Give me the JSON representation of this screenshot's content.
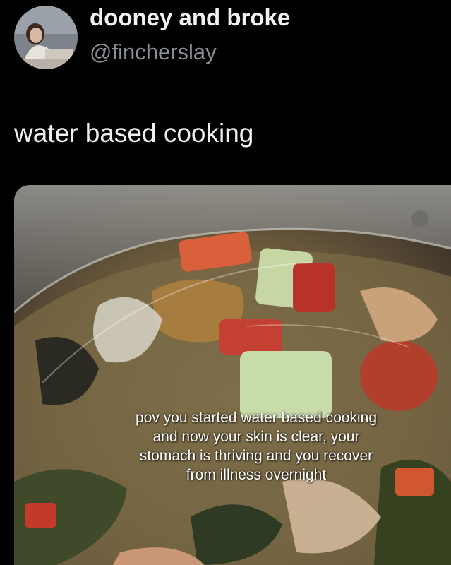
{
  "tweet": {
    "author": {
      "display_name": "dooney and broke",
      "handle": "@fincherslay"
    },
    "text": "water based cooking"
  },
  "media": {
    "caption_lines": [
      "pov you started water based cooking",
      "and now your skin is clear, your",
      "stomach is thriving and you recover",
      "from illness overnight"
    ]
  }
}
